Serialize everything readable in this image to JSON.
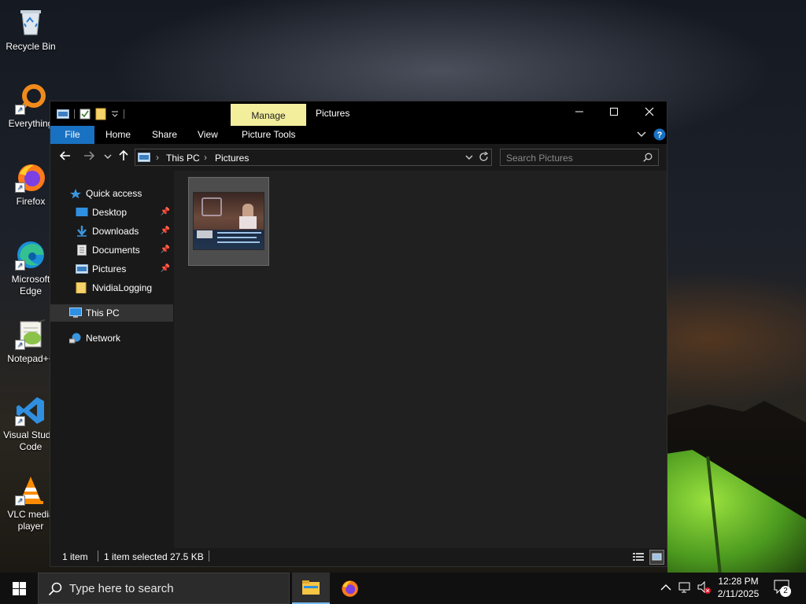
{
  "desktop": {
    "icons": [
      {
        "label": "Recycle Bin",
        "icon": "recycle-bin-icon"
      },
      {
        "label": "Everything",
        "icon": "everything-search-icon"
      },
      {
        "label": "Firefox",
        "icon": "firefox-icon"
      },
      {
        "label": "Microsoft Edge",
        "icon": "edge-icon"
      },
      {
        "label": "Notepad++",
        "icon": "notepad-plus-plus-icon"
      },
      {
        "label": "Visual Studio Code",
        "icon": "vscode-icon"
      },
      {
        "label": "VLC media player",
        "icon": "vlc-icon"
      }
    ]
  },
  "window": {
    "title": "Pictures",
    "contextual_tab": "Manage",
    "menu": {
      "file": "File",
      "home": "Home",
      "share": "Share",
      "view": "View",
      "picture_tools": "Picture Tools"
    },
    "breadcrumb": [
      "This PC",
      "Pictures"
    ],
    "search_placeholder": "Search Pictures",
    "nav": {
      "quick_access": "Quick access",
      "desktop": "Desktop",
      "downloads": "Downloads",
      "documents": "Documents",
      "pictures": "Pictures",
      "nvidia_logging": "NvidiaLogging",
      "this_pc": "This PC",
      "network": "Network"
    },
    "files": [
      {
        "name": "",
        "type": "image"
      }
    ],
    "status": {
      "count": "1 item",
      "selected": "1 item selected",
      "size": "27.5 KB"
    }
  },
  "taskbar": {
    "search_placeholder": "Type here to search",
    "time": "12:28 PM",
    "date": "2/11/2025",
    "notification_count": "2"
  },
  "colors": {
    "accent": "#1971c2",
    "manage_tab": "#f3ee9c",
    "window_bg": "#191919",
    "content_bg": "#202020"
  }
}
